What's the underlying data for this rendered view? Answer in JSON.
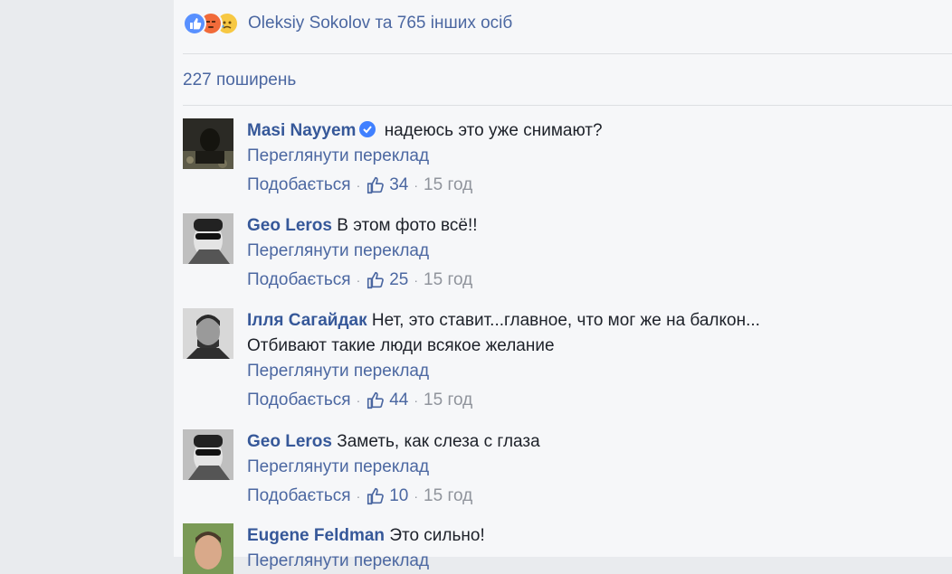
{
  "reactions": {
    "icons": [
      "like-icon",
      "angry-icon",
      "sad-icon"
    ],
    "summary": "Oleksiy Sokolov та 765 інших осіб"
  },
  "shares": "227 поширень",
  "comments": [
    {
      "author": "Masi Nayyem",
      "verified": true,
      "text": "надеюсь это уже снимают?",
      "text2": "",
      "translate": "Переглянути переклад",
      "like_label": "Подобається",
      "likes": "34",
      "time": "15 год"
    },
    {
      "author": "Geo Leros",
      "verified": false,
      "text": "В этом фото всё!!",
      "text2": "",
      "translate": "Переглянути переклад",
      "like_label": "Подобається",
      "likes": "25",
      "time": "15 год"
    },
    {
      "author": "Ілля Сагайдак",
      "verified": false,
      "text": "Нет, это ставит...главное, что мог же на балкон...",
      "text2": "Отбивают такие люди всякое желание",
      "translate": "Переглянути переклад",
      "like_label": "Подобається",
      "likes": "44",
      "time": "15 год"
    },
    {
      "author": "Geo Leros",
      "verified": false,
      "text": "Заметь, как слеза с глаза",
      "text2": "",
      "translate": "Переглянути переклад",
      "like_label": "Подобається",
      "likes": "10",
      "time": "15 год"
    },
    {
      "author": "Eugene Feldman",
      "verified": false,
      "text": "Это сильно!",
      "text2": "",
      "translate": "Переглянути переклад",
      "like_label": "",
      "likes": "",
      "time": ""
    }
  ],
  "colors": {
    "link": "#365899",
    "meta": "#4b67a1",
    "time": "#90949c",
    "panel": "#f6f7f9"
  }
}
